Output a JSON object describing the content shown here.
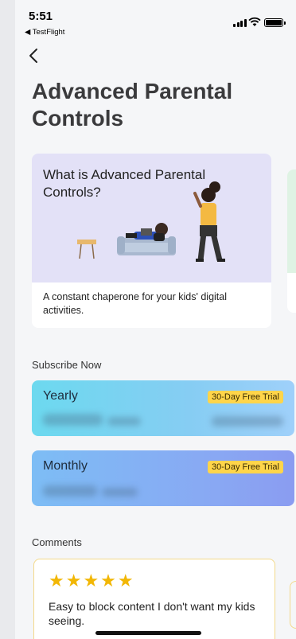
{
  "status_bar": {
    "time": "5:51",
    "back_app": "◀ TestFlight"
  },
  "page": {
    "title": "Advanced Parental Controls"
  },
  "feature_card": {
    "heading": "What is Advanced Parental Controls?",
    "description": "A constant chaperone for your kids' digital activities."
  },
  "subscribe": {
    "section_label": "Subscribe Now",
    "plans": [
      {
        "name": "Yearly",
        "badge": "30-Day Free Trial"
      },
      {
        "name": "Monthly",
        "badge": "30-Day Free Trial"
      }
    ]
  },
  "comments": {
    "section_label": "Comments",
    "reviews": [
      {
        "stars": "★★★★★",
        "text": "Easy to block content I don't want my kids seeing."
      }
    ]
  },
  "colors": {
    "accent_yellow": "#ffd54a",
    "star": "#f2b705"
  }
}
